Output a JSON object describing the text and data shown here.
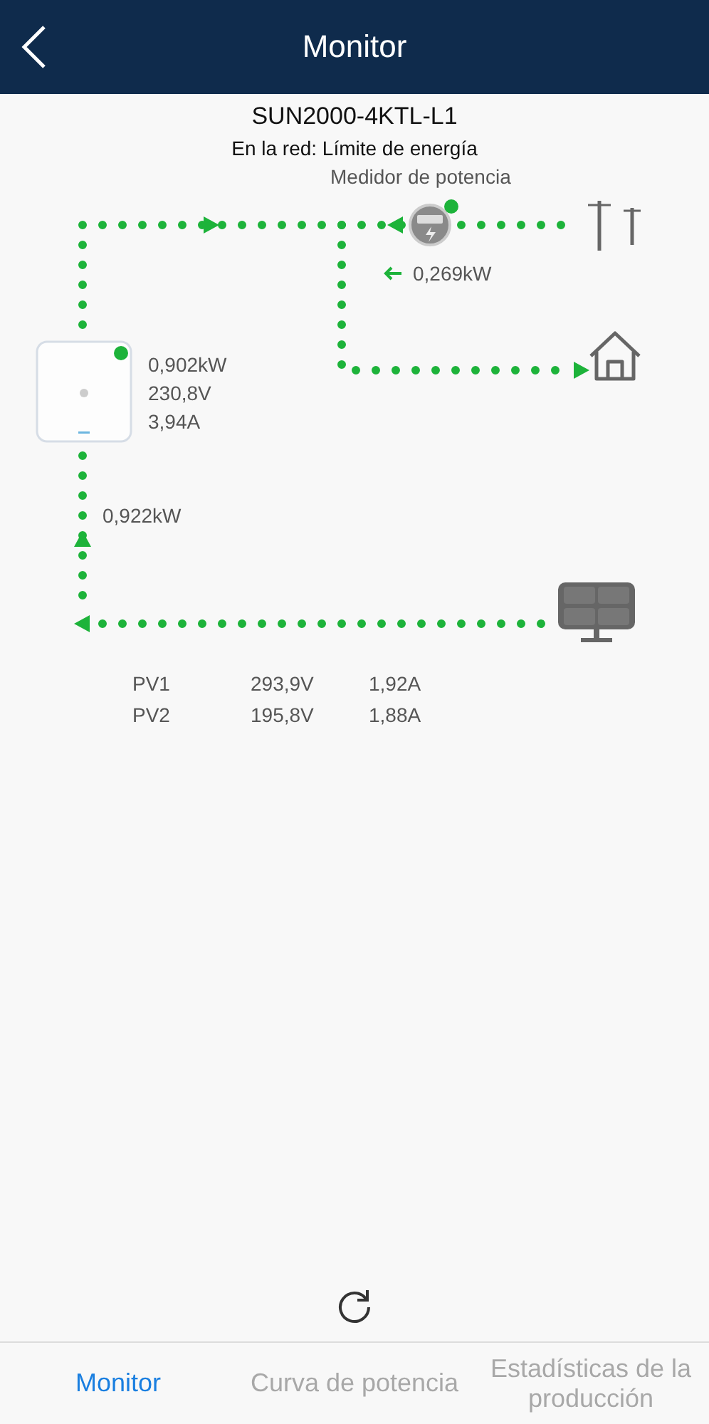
{
  "header": {
    "title": "Monitor"
  },
  "device": {
    "name": "SUN2000-4KTL-L1",
    "status": "En la red: Límite de energía"
  },
  "meter": {
    "label": "Medidor de potencia",
    "online": true,
    "power": "0,269kW"
  },
  "inverter": {
    "online": true,
    "readings": [
      "0,902kW",
      "230,8V",
      "3,94A"
    ]
  },
  "pv_input": {
    "power": "0,922kW"
  },
  "pv_strings": [
    {
      "name": "PV1",
      "voltage": "293,9V",
      "current": "1,92A"
    },
    {
      "name": "PV2",
      "voltage": "195,8V",
      "current": "1,88A"
    }
  ],
  "tabs": [
    {
      "label": "Monitor",
      "selected": true
    },
    {
      "label": "Curva de potencia",
      "selected": false
    },
    {
      "label": "Estadísticas de la producción",
      "selected": false
    }
  ]
}
